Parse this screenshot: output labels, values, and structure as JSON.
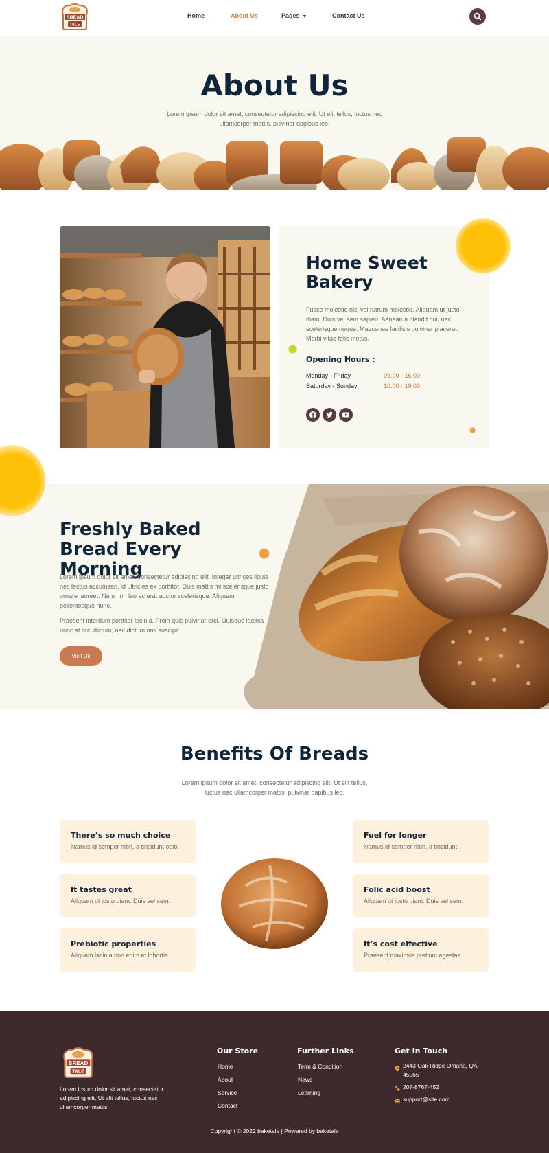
{
  "brand": {
    "logo_line1": "BREAD",
    "logo_line2": "TALE"
  },
  "nav": {
    "items": [
      {
        "label": "Home",
        "active": false
      },
      {
        "label": "About Us",
        "active": true
      },
      {
        "label": "Pages",
        "active": false,
        "has_dropdown": true
      },
      {
        "label": "Contact Us",
        "active": false
      }
    ],
    "search_icon": "search-icon"
  },
  "hero": {
    "title": "About Us",
    "subtitle": "Lorem ipsum dolor sit amet, consectetur adipiscing elit. Ut elit tellus, luctus nec ullamcorper mattis, pulvinar dapibus leo."
  },
  "about": {
    "title": "Home Sweet Bakery",
    "description": "Fusce molestie nisl vel rutrum molestie. Aliquam ut justo diam. Duis vel sem sapien. Aenean a blandit dui, nec scelerisque neque. Maecenas facilisis pulvinar placerat. Morbi vitae felis metus.",
    "hours_title": "Opening Hours :",
    "hours": [
      {
        "day": "Monday - Friday",
        "time": "09.00 - 16.00"
      },
      {
        "day": "Saturday - Sunday",
        "time": "10.00 - 19.00"
      }
    ],
    "social": [
      "facebook-icon",
      "twitter-icon",
      "youtube-icon"
    ]
  },
  "fresh": {
    "title": "Freshly Baked Bread Every Morning",
    "paragraph1": "Lorem ipsum dolor sit amet, consectetur adipiscing elit. Integer ultrices ligula nec lectus accumsan, id ultricies ex porttitor. Duis mattis mi scelerisque justo ornare laoreet. Nam non leo ac erat auctor scelerisque. Aliquam pellentesque nunc.",
    "paragraph2": "Praesent interdum porttitor lacinia. Proin quis pulvinar orci. Quisque lacinia nunc at orci dictum, nec dictum orci suscipit.",
    "button": "Visit Us"
  },
  "benefits": {
    "title": "Benefits Of Breads",
    "description": "Lorem ipsum dolor sit amet, consectetur adipiscing elit. Ut elit tellus, luctus nec ullamcorper mattis, pulvinar dapibus leo.",
    "left": [
      {
        "title": "There’s so much choice",
        "text": "ivamus id semper nibh, a tincidunt odio."
      },
      {
        "title": "It tastes great",
        "text": "Aliquam ut justo diam. Duis vel sem."
      },
      {
        "title": "Prebiotic properties",
        "text": "Aliquam lacinia non enim et lobortis."
      }
    ],
    "right": [
      {
        "title": "Fuel for longer",
        "text": "ivamus id semper nibh, a tincidunt."
      },
      {
        "title": "Folic acid boost",
        "text": "Aliquam ut justo diam. Duis vel sem."
      },
      {
        "title": "It’s cost effective",
        "text": "Praesent maximus pretium egestas"
      }
    ]
  },
  "footer": {
    "description": "Lorem ipsum dolor sit amet, consectetur adipiscing elit. Ut elit tellus, luctus nec ullamcorper mattis.",
    "store_title": "Our Store",
    "store_links": [
      "Home",
      "About",
      "Service",
      "Contact"
    ],
    "further_title": "Further Links",
    "further_links": [
      "Term & Condition",
      "News",
      "Learning"
    ],
    "contact_title": "Get In Touch",
    "address": "2443 Oak Ridge Omaha, QA 45065",
    "phone": "207-8767-452",
    "email": "support@site.com",
    "copyright": "Copyright © 2022 baketale | Powered by baketale"
  },
  "colors": {
    "primary_dark": "#10243a",
    "accent": "#c98552",
    "brown": "#5a3b3e",
    "footer_bg": "#3e2a2d",
    "cream": "#f8f8ee",
    "card": "#fdf0dc"
  }
}
